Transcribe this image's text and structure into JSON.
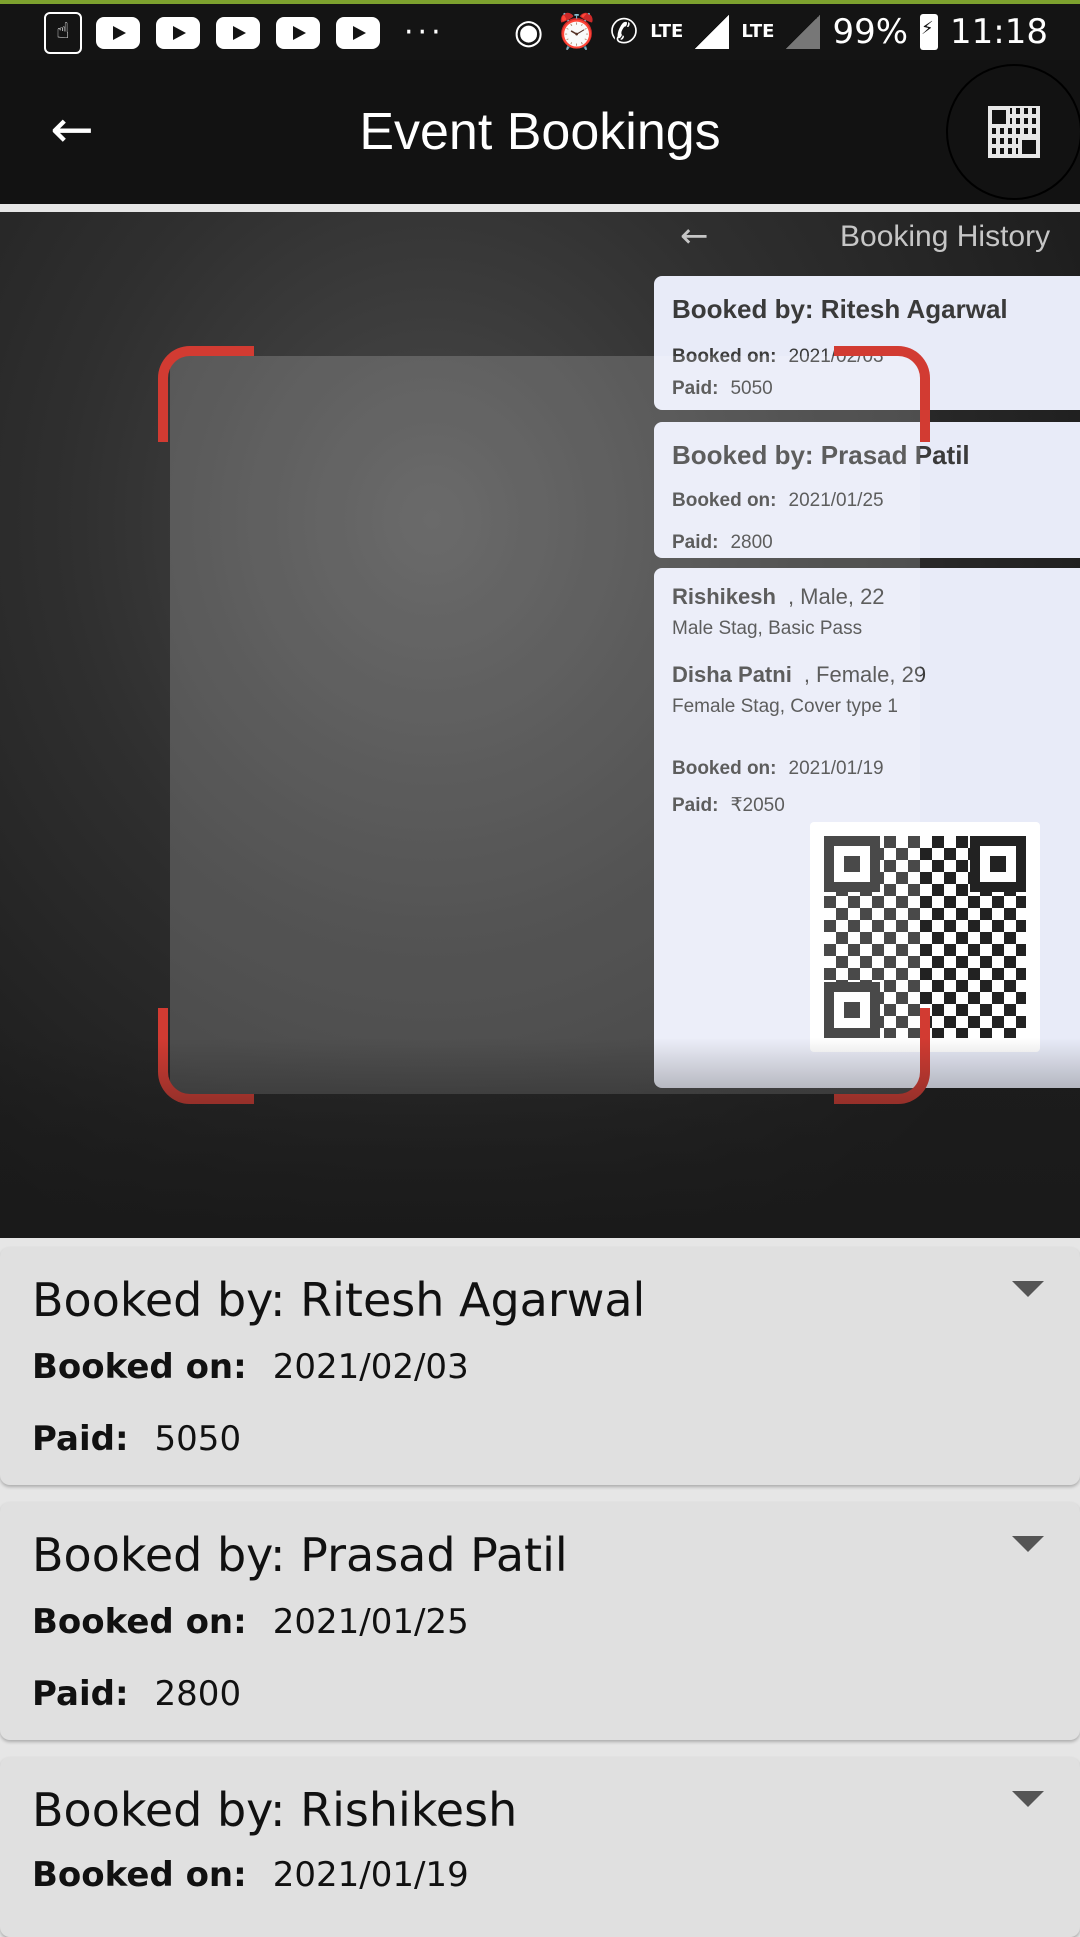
{
  "status_bar": {
    "battery": "99%",
    "time": "11:18",
    "lte_label": "LTE",
    "lte_label_2": "LTE",
    "icons": [
      "accessibility-icon",
      "youtube-icon",
      "youtube-icon",
      "youtube-icon",
      "youtube-icon",
      "youtube-icon",
      "more-dots-icon",
      "hotspot-icon",
      "alarm-icon",
      "volte-call-icon",
      "signal-icon",
      "signal-icon",
      "battery-icon"
    ]
  },
  "app_bar": {
    "title": "Event Bookings",
    "back_icon": "←",
    "qr_icon": "qr-code-icon"
  },
  "camera_preview": {
    "header_arrow": "←",
    "header_title": "Booking History",
    "cards": [
      {
        "name": "Booked by: Ritesh Agarwal",
        "booked_label": "Booked on:",
        "booked": "2021/02/03",
        "paid_label": "Paid:",
        "paid": "5050"
      },
      {
        "name": "Booked by: Prasad Patil",
        "booked_label": "Booked on:",
        "booked": "2021/01/25",
        "paid_label": "Paid:",
        "paid": "2800"
      },
      {
        "attendee1": "Rishikesh",
        "attendee1_info": ", Male, 22",
        "attendee1_pass": "Male Stag, Basic Pass",
        "attendee2": "Disha Patni",
        "attendee2_info": ", Female, 29",
        "attendee2_pass": "Female Stag, Cover type 1",
        "booked_label": "Booked on:",
        "booked": "2021/01/19",
        "paid_label": "Paid:",
        "paid": "₹2050"
      }
    ],
    "scanner_color": "#d23b32"
  },
  "bookings": [
    {
      "name": "Booked by: Ritesh Agarwal",
      "booked_label": "Booked on:",
      "booked": "2021/02/03",
      "paid_label": "Paid:",
      "paid": "5050"
    },
    {
      "name": "Booked by: Prasad Patil",
      "booked_label": "Booked on:",
      "booked": "2021/01/25",
      "paid_label": "Paid:",
      "paid": "2800"
    },
    {
      "name": "Booked by: Rishikesh",
      "booked_label": "Booked on:",
      "booked": "2021/01/19"
    }
  ]
}
